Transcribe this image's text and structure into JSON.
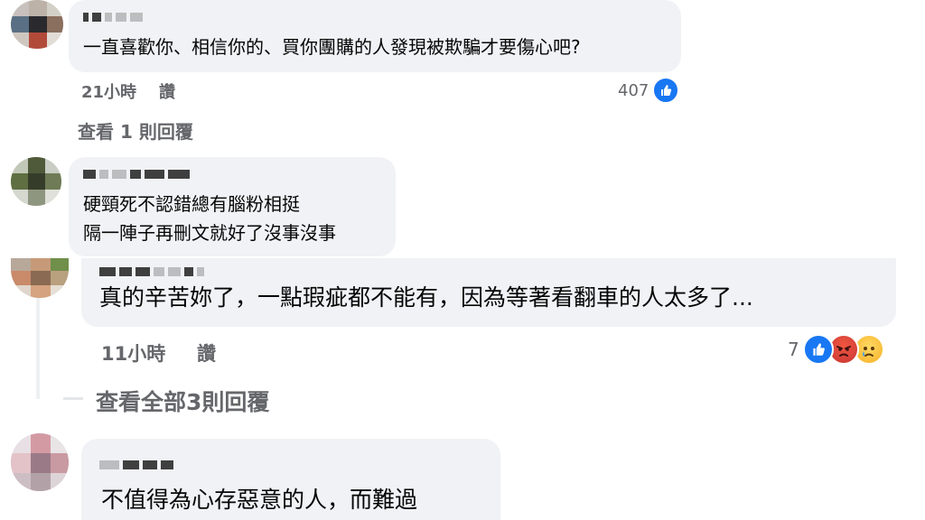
{
  "comments": [
    {
      "text": "一直喜歡你、相信你的、買你團購的人發現被欺騙才要傷心吧?",
      "time": "21小時",
      "like_label": "讚",
      "reaction_count": "407",
      "reactions": [
        "like-icon"
      ],
      "replies_link": "查看 1 則回覆"
    },
    {
      "text_lines": [
        "硬頸死不認錯總有腦粉相挺",
        "隔一陣子再刪文就好了沒事沒事"
      ]
    },
    {
      "text": "真的辛苦妳了，一點瑕疵都不能有，因為等著看翻車的人太多了...",
      "time": "11小時",
      "like_label": "讚",
      "reaction_count": "7",
      "reactions": [
        "like-icon",
        "angry-icon",
        "sad-icon"
      ],
      "replies_link": "查看全部3則回覆"
    },
    {
      "text": "不值得為心存惡意的人，而難過"
    }
  ],
  "colors": {
    "like_blue": "#1877f2",
    "bubble": "#f0f2f5",
    "meta": "#65676b"
  }
}
